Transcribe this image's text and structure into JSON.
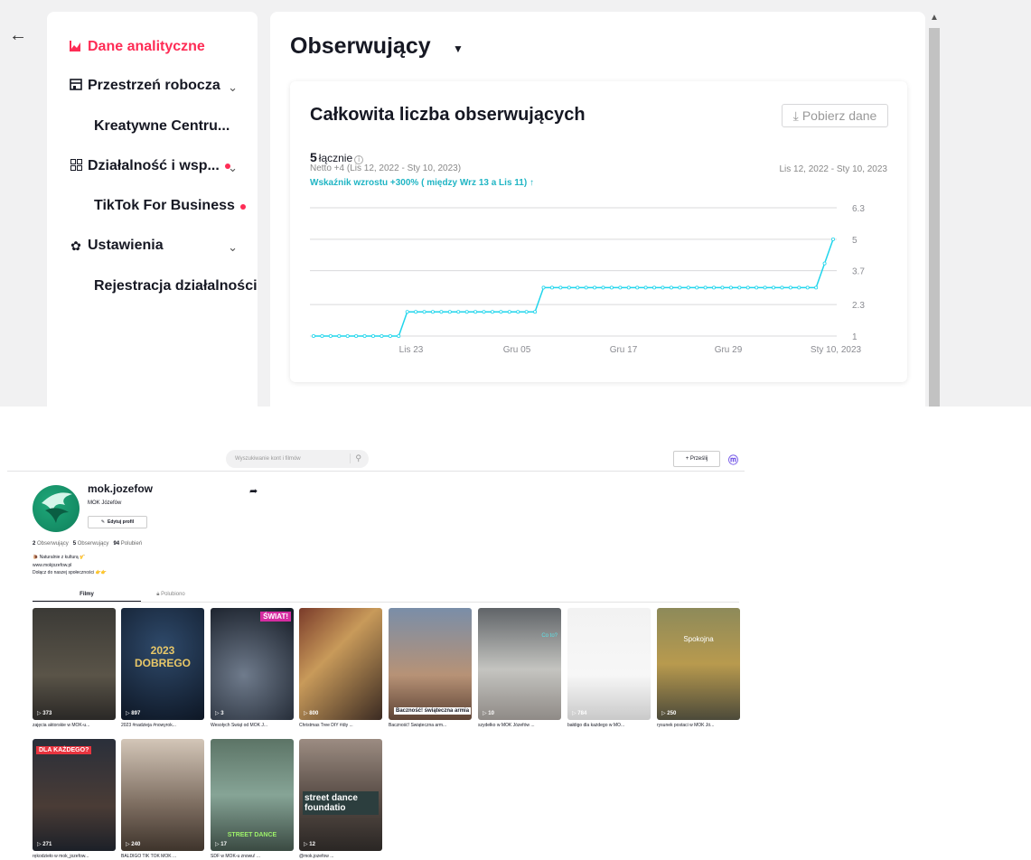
{
  "sidebar": {
    "items": [
      {
        "label": "Dane analityczne",
        "icon": "analytics-icon"
      },
      {
        "label": "Przestrzeń robocza",
        "icon": "workspace-icon"
      },
      {
        "label": "Kreatywne Centru..."
      },
      {
        "label": "Działalność i wsp...",
        "icon": "business-icon"
      },
      {
        "label": "TikTok For Business"
      },
      {
        "label": "Ustawienia",
        "icon": "gear-icon"
      },
      {
        "label": "Rejestracja działalności"
      }
    ],
    "active_color": "#fe2c55"
  },
  "main": {
    "title": "Obserwujący",
    "card": {
      "title": "Całkowita liczba obserwujących",
      "download_label": "Pobierz dane",
      "total_value": "5",
      "total_label": "łącznie",
      "netto": "Netto +4 (Lis 12, 2022 - Sty 10, 2023)",
      "date_range": "Lis 12, 2022 - Sty 10, 2023",
      "growth": "Wskaźnik wzrostu +300% ( między Wrz 13 a Lis 11)"
    }
  },
  "chart_data": {
    "type": "line",
    "title": "Całkowita liczba obserwujących",
    "series": [
      {
        "values": [
          1,
          1,
          1,
          1,
          1,
          1,
          1,
          1,
          1,
          1,
          1,
          2,
          2,
          2,
          2,
          2,
          2,
          2,
          2,
          2,
          2,
          2,
          2,
          2,
          2,
          2,
          2,
          3,
          3,
          3,
          3,
          3,
          3,
          3,
          3,
          3,
          3,
          3,
          3,
          3,
          3,
          3,
          3,
          3,
          3,
          3,
          3,
          3,
          3,
          3,
          3,
          3,
          3,
          3,
          3,
          3,
          3,
          3,
          3,
          3,
          4,
          5
        ],
        "color": "#20d5ec"
      }
    ],
    "x_tick_labels": [
      "Lis 23",
      "Gru 05",
      "Gru 17",
      "Gru 29",
      "Sty 10, 2023"
    ],
    "y_tick_labels": [
      "6.3",
      "5",
      "3.7",
      "2.3",
      "1"
    ],
    "ylim": [
      1,
      6.3
    ],
    "grid": true
  },
  "profile": {
    "search_placeholder": "Wyszukiwanie kont i filmów",
    "upload_label": "+ Prześlij",
    "username": "mok.jozefow",
    "nickname": "MOK Józefów",
    "edit_label": "Edytuj profil",
    "stats": {
      "following_count": "2",
      "following_label": "Obserwujący",
      "followers_count": "5",
      "followers_label": "Obserwujący",
      "likes_count": "94",
      "likes_label": "Polubień"
    },
    "bio": [
      "🐌 Naturalnie z kulturą 🎷",
      "www.mokjozefow.pl",
      "Dołącz do naszej społeczności 👉👉"
    ],
    "tabs": [
      "Filmy",
      "Polubiono"
    ],
    "videos": [
      {
        "views": "373",
        "caption": "zajęcia aktorskie w MOK-u...",
        "overlay": ""
      },
      {
        "views": "897",
        "caption": "2023 #nadzieja #nowyrok...",
        "overlay": "2023 DOBREGO"
      },
      {
        "views": "3",
        "caption": "Wesołych Świąt od MOK J...",
        "overlay": "ŚWIAT!"
      },
      {
        "views": "800",
        "caption": "Christmas Tree DIY #diy ...",
        "overlay": ""
      },
      {
        "views": "",
        "caption": "Baczność! Świąteczna arm...",
        "overlay": "Baczność! świąteczna armia"
      },
      {
        "views": "10",
        "caption": "szydełko w MOK Józefów ...",
        "overlay": "Co to?"
      },
      {
        "views": "784",
        "caption": "bałdigo dla każdego w MO...",
        "overlay": ""
      },
      {
        "views": "250",
        "caption": "rysunek postaci w MOK Jó...",
        "overlay": "Spokojna"
      },
      {
        "views": "271",
        "caption": "rękodzieło w mok_jozefow...",
        "overlay": "DLA KAŻDEGO?"
      },
      {
        "views": "240",
        "caption": "BALDIGO TIK TOK MOK ...",
        "overlay": ""
      },
      {
        "views": "17",
        "caption": "SDF w MOK-u znowu! ...",
        "overlay": "STREET DANCE"
      },
      {
        "views": "12",
        "caption": "@mok.jozefow ...",
        "overlay": "street dance foundatio"
      }
    ]
  }
}
